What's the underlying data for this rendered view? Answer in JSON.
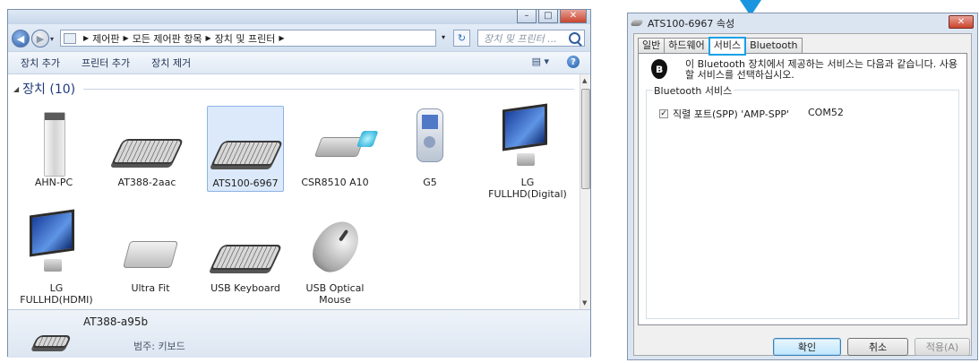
{
  "left_window": {
    "breadcrumb": [
      "제어판",
      "모든 제어판 항목",
      "장치 및 프린터"
    ],
    "search_placeholder": "장치 및 프린터 ...",
    "toolbar": [
      "장치 추가",
      "프린터 추가",
      "장치 제거"
    ],
    "group_title": "장치 (10)",
    "devices": [
      {
        "label": "AHN-PC",
        "icon": "pc-tower-icon"
      },
      {
        "label": "AT388-2aac",
        "icon": "keyboard-icon"
      },
      {
        "label": "ATS100-6967",
        "icon": "keyboard-icon",
        "selected": true
      },
      {
        "label": "CSR8510 A10",
        "icon": "usb-dongle-icon"
      },
      {
        "label": "G5",
        "icon": "media-player-icon"
      },
      {
        "label": "LG FULLHD(Digital)",
        "icon": "monitor-icon"
      },
      {
        "label": "LG FULLHD(HDMI)",
        "icon": "monitor-icon"
      },
      {
        "label": "Ultra Fit",
        "icon": "drive-icon"
      },
      {
        "label": "USB Keyboard",
        "icon": "keyboard-icon"
      },
      {
        "label": "USB Optical Mouse",
        "icon": "mouse-icon"
      }
    ],
    "details": {
      "name": "AT388-a95b",
      "category": "범주: 키보드"
    }
  },
  "right_window": {
    "title": "ATS100-6967 속성",
    "tabs": [
      "일반",
      "하드웨어",
      "서비스",
      "Bluetooth"
    ],
    "active_tab": "서비스",
    "description": "이 Bluetooth 장치에서 제공하는 서비스는 다음과 같습니다. 사용할 서비스를 선택하십시오.",
    "group_label": "Bluetooth 서비스",
    "services": [
      {
        "name": "직렬 포트(SPP) 'AMP-SPP'",
        "port": "COM52",
        "checked": true
      }
    ],
    "buttons": {
      "ok": "확인",
      "cancel": "취소",
      "apply": "적용(A)"
    }
  },
  "colors": {
    "highlight": "#1aa0e8",
    "selection": "#dbe9fb"
  }
}
